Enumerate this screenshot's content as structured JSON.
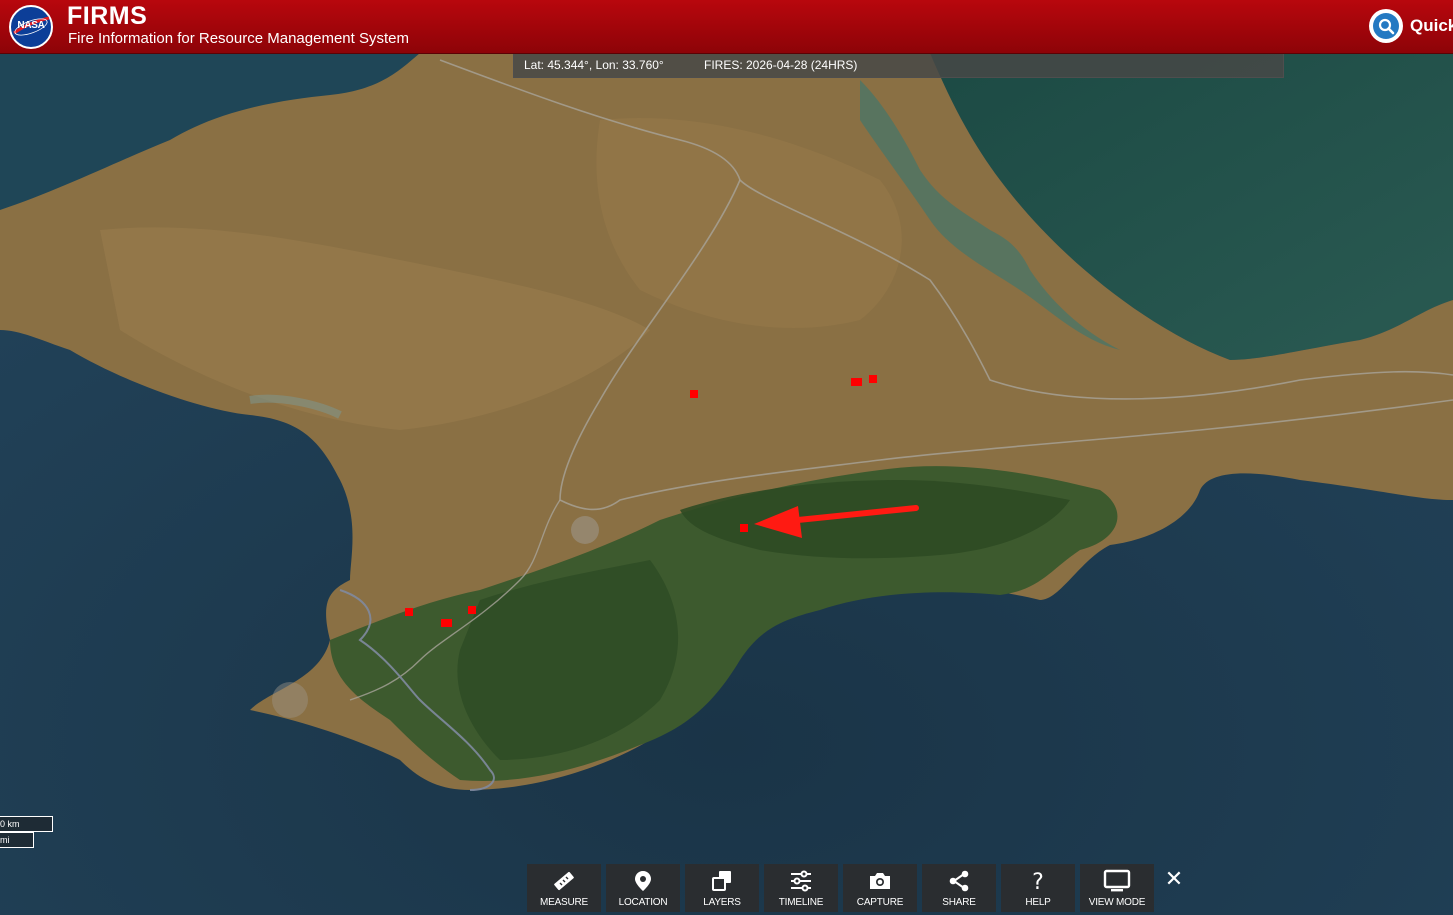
{
  "header": {
    "logo_text": "NASA",
    "title": "FIRMS",
    "subtitle": "Fire Information for Resource Management System",
    "quick_label": "Quick"
  },
  "infobar": {
    "coordinates": "Lat: 45.344°, Lon: 33.760°",
    "fires": "FIRES: 2026-04-28 (24HRS)"
  },
  "scale": {
    "km_label": "0 km",
    "mi_label": "mi"
  },
  "toolbar": {
    "items": [
      {
        "label": "MEASURE",
        "icon": "ruler-icon"
      },
      {
        "label": "LOCATION",
        "icon": "map-pin-icon"
      },
      {
        "label": "LAYERS",
        "icon": "layers-icon"
      },
      {
        "label": "TIMELINE",
        "icon": "sliders-icon"
      },
      {
        "label": "CAPTURE",
        "icon": "camera-icon"
      },
      {
        "label": "SHARE",
        "icon": "share-icon"
      },
      {
        "label": "HELP",
        "icon": "question-icon"
      },
      {
        "label": "VIEW MODE",
        "icon": "monitor-icon"
      }
    ],
    "close": "✕"
  },
  "colors": {
    "header_red": "#a8060b",
    "fire_red": "#ff0000",
    "sea": "#1f3d52",
    "land": "#8a7044",
    "forest": "#3d5a2e"
  },
  "fires_count_visible": 8
}
